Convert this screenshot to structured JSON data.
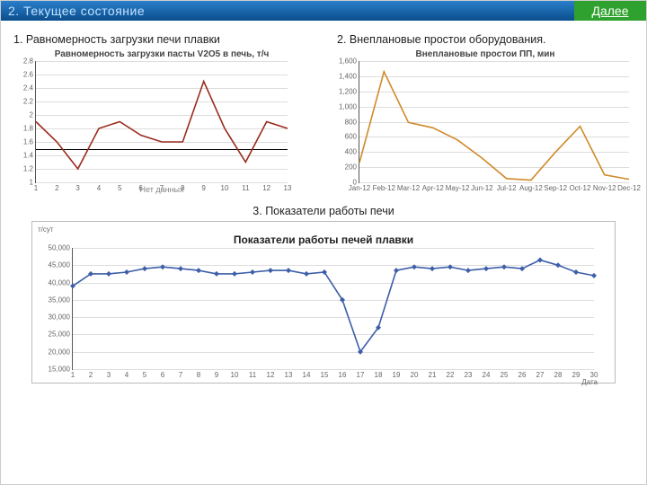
{
  "topbar": {
    "left_label": "2.  Текущее состояние",
    "next_label": "Далее"
  },
  "section1": {
    "heading": "1. Равномерность загрузки печи плавки",
    "note": "Нет данных"
  },
  "section2": {
    "heading": "2. Внеплановые простои оборудования."
  },
  "section3": {
    "heading": "3. Показатели работы печи"
  },
  "chart_data": [
    {
      "id": "uniformity",
      "type": "line",
      "title": "Равномерность загрузки пасты V2O5 в печь, т/ч",
      "xlabel": "",
      "ylabel": "",
      "ylim": [
        1,
        2.8
      ],
      "yticks": [
        1,
        1.2,
        1.4,
        1.6,
        1.8,
        2,
        2.2,
        2.4,
        2.6,
        2.8
      ],
      "categories": [
        "1",
        "2",
        "3",
        "4",
        "5",
        "6",
        "7",
        "8",
        "9",
        "10",
        "11",
        "12",
        "13"
      ],
      "values": [
        1.9,
        1.6,
        1.2,
        1.8,
        1.9,
        1.7,
        1.6,
        1.6,
        2.5,
        1.8,
        1.3,
        1.9,
        1.8
      ],
      "reference_line": 1.5,
      "color": "#9a2b1f"
    },
    {
      "id": "downtime",
      "type": "line",
      "title": "Внеплановые простои ПП, мин",
      "xlabel": "",
      "ylabel": "",
      "ylim": [
        0,
        1600
      ],
      "yticks": [
        0,
        200,
        400,
        600,
        800,
        1000,
        1200,
        1400,
        1600
      ],
      "categories": [
        "Jan-12",
        "Feb-12",
        "Mar-12",
        "Apr-12",
        "May-12",
        "Jun-12",
        "Jul-12",
        "Aug-12",
        "Sep-12",
        "Oct-12",
        "Nov-12",
        "Dec-12"
      ],
      "values": [
        260,
        1460,
        790,
        720,
        560,
        320,
        50,
        30,
        400,
        740,
        100,
        40
      ],
      "color": "#d08a2a"
    },
    {
      "id": "performance",
      "type": "line",
      "title": "Показатели работы печей плавки",
      "ylabel": "т/сут",
      "xlabel": "Дата",
      "ylim": [
        15000,
        50000
      ],
      "yticks": [
        15000,
        20000,
        25000,
        30000,
        35000,
        40000,
        45000,
        50000
      ],
      "categories": [
        "1",
        "2",
        "3",
        "4",
        "5",
        "6",
        "7",
        "8",
        "9",
        "10",
        "11",
        "12",
        "13",
        "14",
        "15",
        "16",
        "17",
        "18",
        "19",
        "20",
        "21",
        "22",
        "23",
        "24",
        "25",
        "26",
        "27",
        "28",
        "29",
        "30"
      ],
      "values": [
        39000,
        42500,
        42500,
        43000,
        44000,
        44500,
        44000,
        43500,
        42500,
        42500,
        43000,
        43500,
        43500,
        42500,
        43000,
        35000,
        20000,
        27000,
        43500,
        44500,
        44000,
        44500,
        43500,
        44000,
        44500,
        44000,
        46500,
        45000,
        43000,
        42000
      ],
      "color": "#3d5ea8",
      "markers": true
    }
  ]
}
